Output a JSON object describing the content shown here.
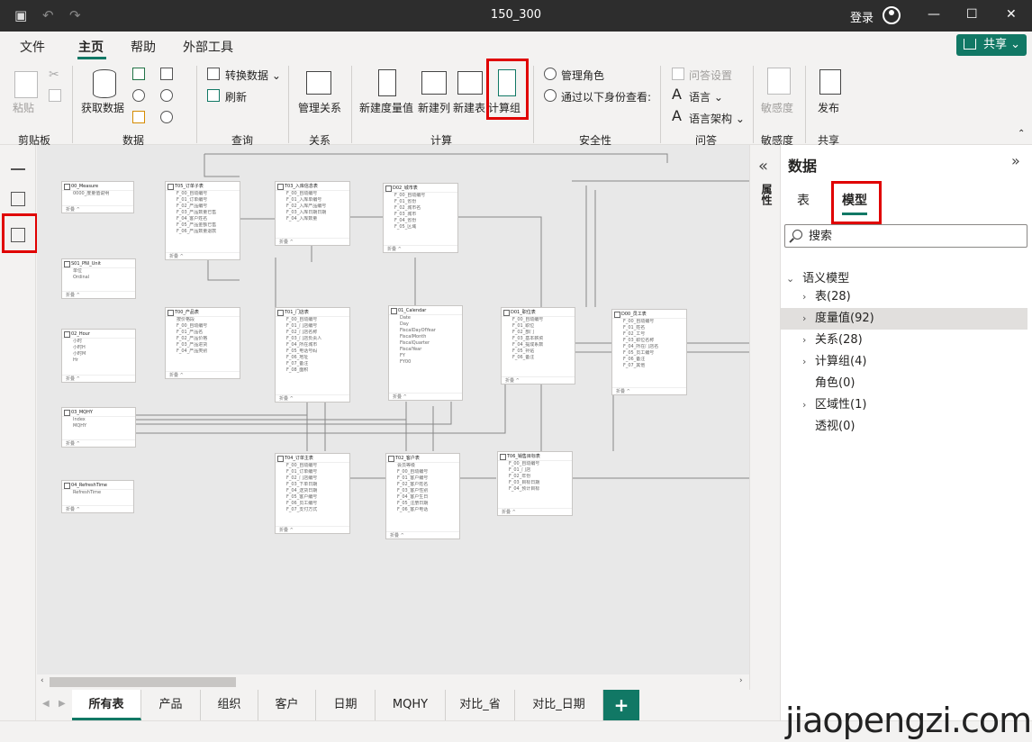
{
  "titlebar": {
    "title": "150_300",
    "login": "登录"
  },
  "menu": {
    "tabs": [
      "文件",
      "主页",
      "帮助",
      "外部工具"
    ],
    "active": "主页",
    "share": "共享"
  },
  "ribbon": {
    "clipboard": {
      "paste": "粘贴",
      "group": "剪贴板"
    },
    "data": {
      "get_data": "获取数据",
      "group": "数据"
    },
    "query": {
      "transform": "转换数据",
      "refresh": "刷新",
      "group": "查询"
    },
    "relations": {
      "manage": "管理关系",
      "group": "关系"
    },
    "calc": {
      "new_measure": "新建度量值",
      "new_column": "新建列",
      "new_table": "新建表",
      "calc_group": "计算组",
      "group": "计算"
    },
    "security": {
      "manage_roles": "管理角色",
      "view_as": "通过以下身份查看:",
      "group": "安全性"
    },
    "qa": {
      "settings": "问答设置",
      "language": "语言",
      "schema": "语言架构",
      "group": "问答"
    },
    "sensitivity": {
      "label": "敏感度",
      "group": "敏感度"
    },
    "share": {
      "publish": "发布",
      "group": "共享"
    }
  },
  "tables": [
    {
      "name": "00_Measure",
      "fields": [
        "0000_度量值说明"
      ],
      "footer": "折叠 ^"
    },
    {
      "name": "T05_订单子表",
      "fields": [
        "F_00_自动编号",
        "F_01_订单编号",
        "F_02_产品编号",
        "F_03_产品数量已售",
        "F_04_客户姓名",
        "F_05_产品金额已售",
        "F_06_产品数量退款"
      ],
      "footer": "折叠 ^"
    },
    {
      "name": "T03_入库信息表",
      "fields": [
        "F_00_自动编号",
        "F_01_入库单编号",
        "F_02_入库产品编号",
        "F_03_入库日期日期",
        "F_04_入库数量"
      ],
      "footer": "折叠 ^"
    },
    {
      "name": "D02_城市表",
      "fields": [
        "F_00_自动编号",
        "F_01_省份",
        "F_02_城市名",
        "F_03_城市",
        "F_04_省份",
        "F_05_区域"
      ],
      "footer": "折叠 ^"
    },
    {
      "name": "S01_PNI_Unit",
      "fields": [
        "单位",
        "Ordinal"
      ],
      "footer": "折叠 ^"
    },
    {
      "name": "T00_产品表",
      "fields": [
        "按价格段",
        "F_00_自动编号",
        "F_01_产品名",
        "F_02_产品价格",
        "F_03_产品进货",
        "F_04_产品类别",
        "F_05_产品销售价"
      ],
      "footer": "折叠 ^"
    },
    {
      "name": "T01_门店表",
      "fields": [
        "F_00_自动编号",
        "F_01_门店编号",
        "F_02_门店名称",
        "F_03_门店负责人",
        "F_04_所在城市",
        "F_05_电话号码",
        "F_06_地址",
        "F_07_备注",
        "F_08_面积"
      ],
      "footer": "折叠 ^"
    },
    {
      "name": "01_Calendar",
      "fields": [
        "Date",
        "Day",
        "FiscalDayOfYear",
        "FiscalMonth",
        "FiscalQuarter",
        "FiscalYear",
        "FY",
        "FY00"
      ],
      "footer": "折叠 ^"
    },
    {
      "name": "D01_职位表",
      "fields": [
        "F_00_自动编号",
        "F_01_职位",
        "F_02_部门",
        "F_03_基本薪资",
        "F_04_提成系数",
        "F_05_补贴",
        "F_06_备注"
      ],
      "footer": "折叠 ^"
    },
    {
      "name": "D00_员工表",
      "fields": [
        "F_00_自动编号",
        "F_01_姓名",
        "F_02_工号",
        "F_03_职位名称",
        "F_04_所在门店名",
        "F_05_员工编号",
        "F_06_备注",
        "F_07_其他"
      ],
      "footer": "折叠 ^"
    },
    {
      "name": "02_Hour",
      "fields": [
        "小时",
        "小时H",
        "小时M",
        "Hr"
      ],
      "footer": "折叠 ^"
    },
    {
      "name": "03_MQHY",
      "fields": [
        "Index",
        "MQHY"
      ],
      "footer": "折叠 ^"
    },
    {
      "name": "T04_订单主表",
      "fields": [
        "F_00_自动编号",
        "F_01_订单编号",
        "F_02_门店编号",
        "F_03_下单日期",
        "F_04_送货日期",
        "F_05_客户编号",
        "F_06_员工编号",
        "F_07_支付方式"
      ],
      "footer": "折叠 ^"
    },
    {
      "name": "T02_客户表",
      "fields": [
        "会员等级",
        "F_00_自动编号",
        "F_01_客户编号",
        "F_02_客户姓名",
        "F_03_客户性别",
        "F_04_客户生日",
        "F_05_注册日期",
        "F_06_客户电话"
      ],
      "footer": "折叠 ^"
    },
    {
      "name": "T06_销售目标表",
      "fields": [
        "F_00_自动编号",
        "F_01_门店",
        "F_02_年份",
        "F_03_目标日期",
        "F_04_预计目标"
      ],
      "footer": "折叠 ^"
    },
    {
      "name": "04_RefreshTime",
      "fields": [
        "RefreshTime"
      ],
      "footer": "折叠 ^"
    }
  ],
  "page_tabs": [
    "所有表",
    "产品",
    "组织",
    "客户",
    "日期",
    "MQHY",
    "对比_省",
    "对比_日期"
  ],
  "page_tab_add": "+",
  "data_pane": {
    "title": "数据",
    "tabs": [
      "表",
      "模型"
    ],
    "active_tab": "模型",
    "search_placeholder": "搜索",
    "root": "语义模型",
    "items": [
      {
        "label": "表(28)",
        "expandable": true
      },
      {
        "label": "度量值(92)",
        "expandable": true,
        "highlighted": true
      },
      {
        "label": "关系(28)",
        "expandable": true
      },
      {
        "label": "计算组(4)",
        "expandable": true
      },
      {
        "label": "角色(0)",
        "expandable": false
      },
      {
        "label": "区域性(1)",
        "expandable": true
      },
      {
        "label": "透视(0)",
        "expandable": false
      }
    ]
  },
  "side_label": "属性",
  "watermark": "jiaopengzi.com",
  "colors": {
    "accent": "#117865",
    "highlight": "#e00000",
    "titlebar": "#2d2d2d"
  }
}
